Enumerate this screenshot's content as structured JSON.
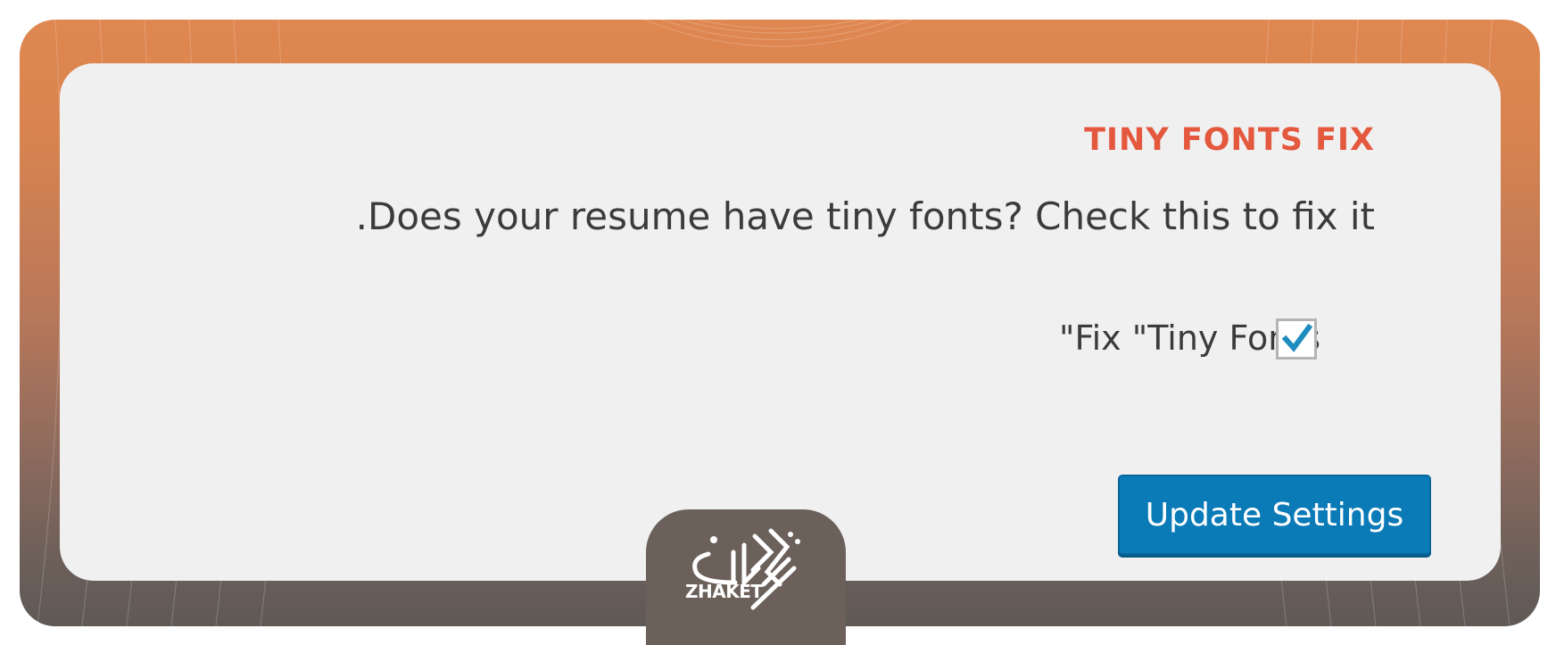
{
  "settings": {
    "section_title": "TINY FONTS FIX",
    "description": "Does your resume have tiny fonts? Check this to fix it.",
    "option_label": "Fix \"Tiny Fonts\"",
    "option_checked": true,
    "checkmark_icon": "checkmark-icon",
    "update_button_label": "Update Settings"
  },
  "watermark": {
    "brand_text": "ZHAKET"
  },
  "colors": {
    "title_accent": "#e4583e",
    "button_blue": "#0b7bb8",
    "frame_orange": "#df8750",
    "frame_dark": "#5f5955"
  }
}
